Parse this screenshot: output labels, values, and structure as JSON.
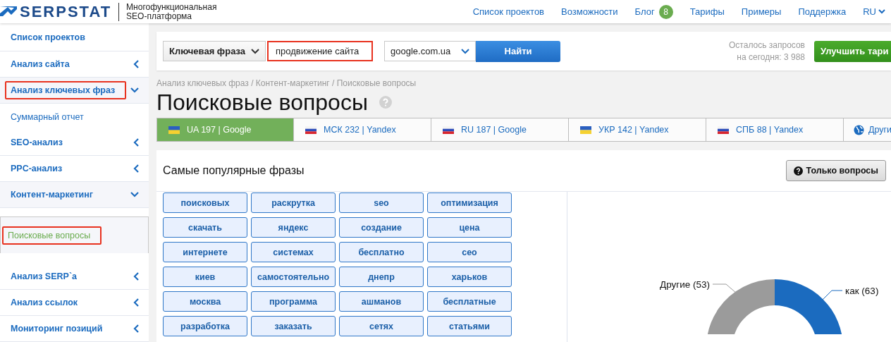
{
  "header": {
    "logo": "SERPSTAT",
    "tagline": [
      "Многофункциональная",
      "SEO-платформа"
    ],
    "nav": [
      {
        "label": "Список проектов"
      },
      {
        "label": "Возможности"
      },
      {
        "label": "Блог",
        "badge": "8"
      },
      {
        "label": "Тарифы"
      },
      {
        "label": "Примеры"
      },
      {
        "label": "Поддержка"
      }
    ],
    "language": "RU"
  },
  "sidebar": {
    "items": [
      {
        "label": "Список проектов",
        "kind": "link",
        "selected": false,
        "highlighted": false
      },
      {
        "label": "Анализ сайта",
        "kind": "section",
        "expanded": false,
        "selected": false,
        "highlighted": false
      },
      {
        "label": "Анализ ключевых фраз",
        "kind": "section",
        "expanded": true,
        "selected": false,
        "highlighted": true
      },
      {
        "label": "Суммарный отчет",
        "kind": "subitem",
        "selected": false,
        "highlighted": false
      },
      {
        "label": "SEO-анализ",
        "kind": "section",
        "expanded": false,
        "selected": false,
        "highlighted": false
      },
      {
        "label": "PPC-анализ",
        "kind": "section",
        "expanded": false,
        "selected": false,
        "highlighted": false
      },
      {
        "label": "Контент-маркетинг",
        "kind": "section",
        "expanded": true,
        "selected": false,
        "highlighted": false
      },
      {
        "label": "Поисковые вопросы",
        "kind": "subitem",
        "selected": true,
        "highlighted": true
      },
      {
        "label": "Анализ SERP`a",
        "kind": "section",
        "expanded": false,
        "selected": false,
        "highlighted": false
      },
      {
        "label": "Анализ ссылок",
        "kind": "section",
        "expanded": false,
        "selected": false,
        "highlighted": false
      },
      {
        "label": "Мониторинг позиций",
        "kind": "section",
        "expanded": false,
        "selected": false,
        "highlighted": false
      }
    ]
  },
  "search": {
    "type_select": "Ключевая фраза",
    "query": "продвижение сайта",
    "query_highlighted": true,
    "engine_select": "google.com.ua",
    "button": "Найти",
    "quota_lines": [
      "Осталось запросов",
      "на сегодня: 3 988"
    ],
    "upgrade_button": "Улучшить тари"
  },
  "breadcrumb": "Анализ ключевых фраз / Контент-маркетинг / Поисковые вопросы",
  "title": "Поисковые вопросы",
  "tabs": [
    {
      "label": "UA 197 | Google",
      "kind": "ua",
      "selected": true
    },
    {
      "label": "МСК 232 | Yandex",
      "kind": "ru",
      "selected": false
    },
    {
      "label": "RU 187 | Google",
      "kind": "ru",
      "selected": false
    },
    {
      "label": "УКР 142 | Yandex",
      "kind": "ua",
      "selected": false
    },
    {
      "label": "СПБ 88 | Yandex",
      "kind": "ru",
      "selected": false
    },
    {
      "label": "Други",
      "kind": "globe",
      "selected": false
    }
  ],
  "panel": {
    "title": "Самые популярные фразы",
    "filter_button": "Только вопросы",
    "phrases": [
      "поисковых",
      "раскрутка",
      "seo",
      "оптимизация",
      "скачать",
      "яндекс",
      "создание",
      "цена",
      "интернете",
      "системах",
      "бесплатно",
      "сео",
      "киев",
      "самостоятельно",
      "днепр",
      "харьков",
      "москва",
      "программа",
      "ашманов",
      "бесплатные",
      "разработка",
      "заказать",
      "сетях",
      "статьями"
    ],
    "donut_labels": [
      {
        "label": "Другие (53)",
        "color": "#9b9b9b"
      },
      {
        "label": "как (63)",
        "color": "#1b6bbf"
      }
    ]
  }
}
